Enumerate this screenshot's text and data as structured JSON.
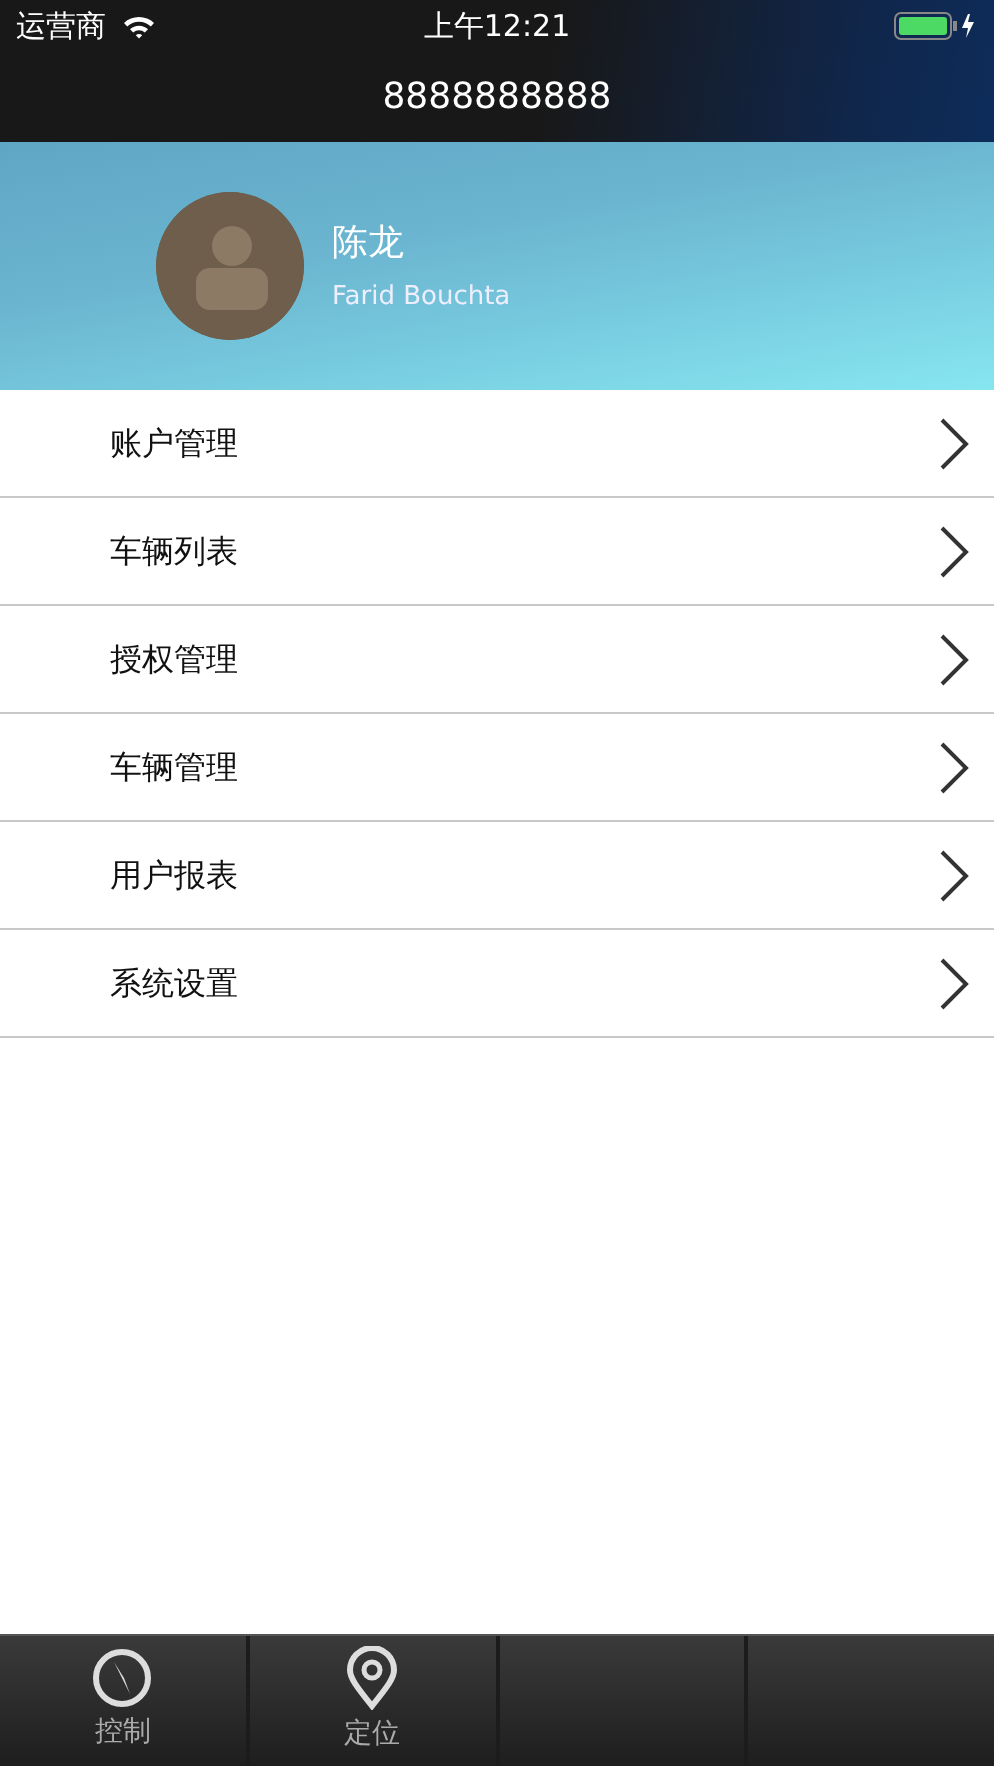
{
  "status_bar": {
    "carrier": "运营商",
    "time": "上午12:21"
  },
  "nav_bar": {
    "title": "8888888888"
  },
  "profile": {
    "name": "陈龙",
    "subtitle": "Farid Bouchta"
  },
  "menu": [
    {
      "label": "账户管理"
    },
    {
      "label": "车辆列表"
    },
    {
      "label": "授权管理"
    },
    {
      "label": "车辆管理"
    },
    {
      "label": "用户报表"
    },
    {
      "label": "系统设置"
    }
  ],
  "tab_bar": [
    {
      "kind": "compass",
      "label": "控制"
    },
    {
      "kind": "pin",
      "label": "定位"
    }
  ]
}
